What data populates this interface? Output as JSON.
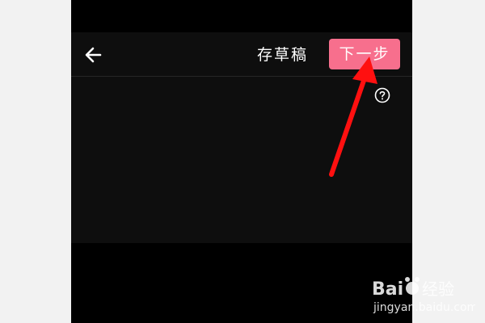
{
  "topbar": {
    "back_icon": "arrow-left-icon",
    "save_draft_label": "存草稿",
    "next_label": "下一步"
  },
  "content": {
    "help_icon": "question-circle-icon"
  },
  "annotation": {
    "arrow_icon": "red-arrow-icon",
    "arrow_color": "#ff1010"
  },
  "watermark": {
    "brand": "Baidu 经验",
    "url": "jingyan.baidu.com"
  },
  "colors": {
    "next_button": "#f76f8d",
    "bar_background": "#0e0e0e",
    "phone_background": "#000000"
  }
}
